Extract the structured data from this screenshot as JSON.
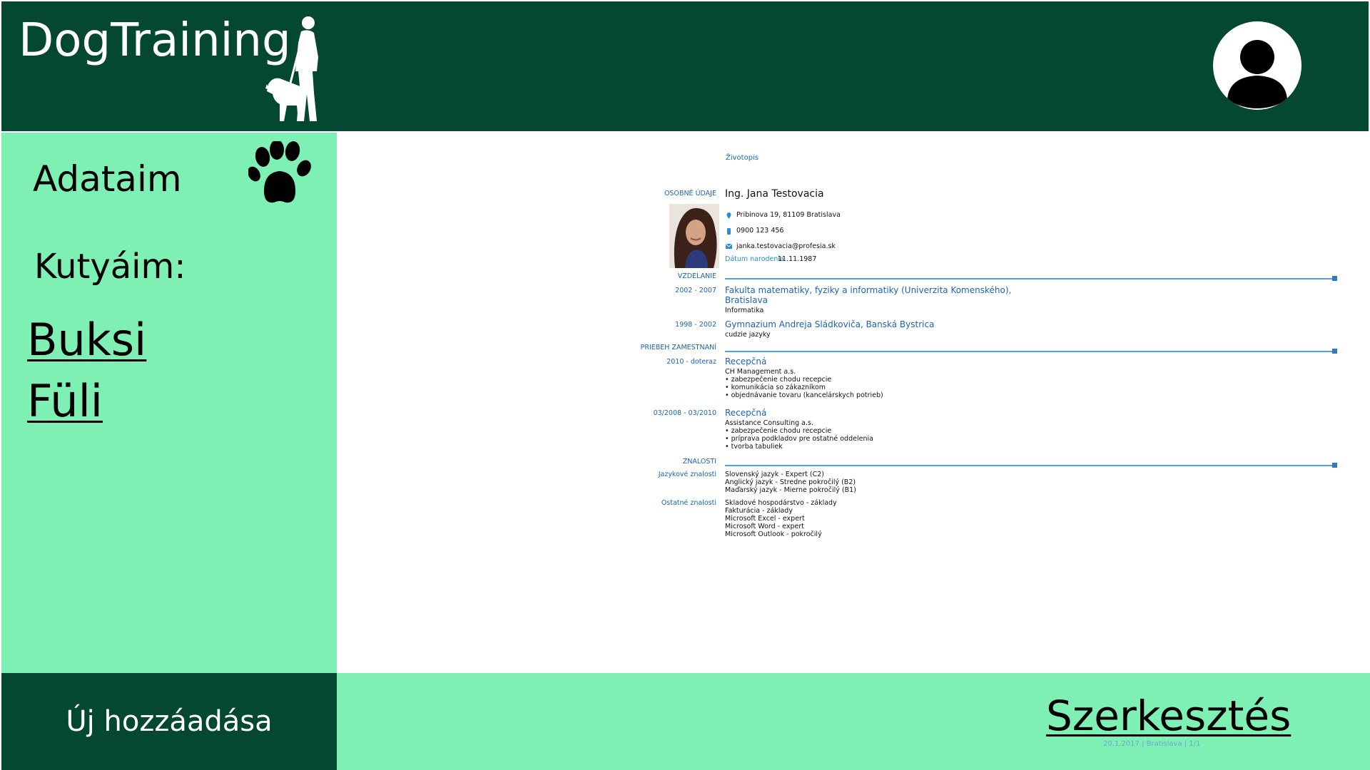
{
  "header": {
    "app_title": "DogTraining",
    "logo_icon": "person-walking-dog-icon",
    "avatar_icon": "user-avatar-icon"
  },
  "sidebar": {
    "heading": "Adataim",
    "heading_icon": "paw-icon",
    "dogs_label": "Kutyáim:",
    "dogs": [
      {
        "name": "Buksi"
      },
      {
        "name": "Füli"
      }
    ]
  },
  "footer": {
    "add_button": "Új hozzáadása",
    "edit_link": "Szerkesztés",
    "cv_footer": "20.1.2017  |  Bratislava  |  1/1"
  },
  "cv": {
    "doc_title": "Životopis",
    "personal_label": "OSOBNÉ ÚDAJE",
    "name": "Ing. Jana Testovacia",
    "address": "Pribinova 19, 81109 Bratislava",
    "phone": "0900 123 456",
    "email": "janka.testovacia@profesia.sk",
    "birth_label": "Dátum narodenia",
    "birth_date": "11.11.1987",
    "education_label": "VZDELANIE",
    "education": [
      {
        "years": "2002 - 2007",
        "school_line1": "Fakulta matematiky, fyziky a informatiky (Univerzita Komenského),",
        "school_line2": "Bratislava",
        "field": "Informatika"
      },
      {
        "years": "1998 - 2002",
        "school_line1": "Gymnazium Andreja Sládkoviča, Banská Bystrica",
        "field": "cudzie jazyky"
      }
    ],
    "employment_label": "PRIEBEH ZAMESTNANÍ",
    "jobs": [
      {
        "period": "2010 - doteraz",
        "title": "Recepčná",
        "company": "CH Management a.s.",
        "duties": [
          "• zabezpečenie chodu recepcie",
          "• komunikácia so zákazníkom",
          "• objednávanie tovaru (kancelárskych potrieb)"
        ]
      },
      {
        "period": "03/2008 - 03/2010",
        "title": "Recepčná",
        "company": "Assistance Consulting a.s.",
        "duties": [
          "• zabezpečenie chodu recepcie",
          "• príprava podkladov pre ostatné oddelenia",
          "• tvorba tabuliek"
        ]
      }
    ],
    "skills_label": "ZNALOSTI",
    "languages_label": "Jazykové znalosti",
    "languages": [
      "Slovenský jazyk - Expert (C2)",
      "Anglický jazyk - Stredne pokročilý (B2)",
      "Maďarský jazyk - Mierne pokročilý (B1)"
    ],
    "other_label": "Ostatné znalosti",
    "other": [
      "Skladové hospodárstvo - základy",
      "Fakturácia - základy",
      "Microsoft Excel - expert",
      "Microsoft Word - expert",
      "Microsoft Outlook - pokročilý"
    ]
  },
  "colors": {
    "dark_green": "#054831",
    "light_green": "#7ff0b3",
    "cv_blue": "#1a63b8"
  }
}
